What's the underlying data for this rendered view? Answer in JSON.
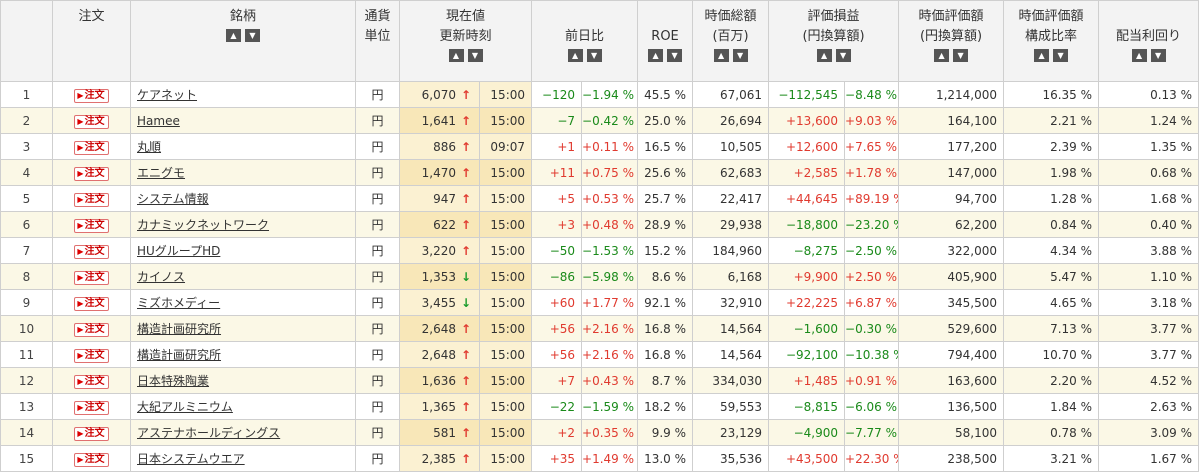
{
  "header": {
    "order": "注文",
    "name": "銘柄",
    "currency_line1": "通貨",
    "currency_line2": "単位",
    "price_line1": "現在値",
    "price_line2": "更新時刻",
    "change": "前日比",
    "roe": "ROE",
    "mcap_line1": "時価総額",
    "mcap_line2": "(百万)",
    "pl_line1": "評価損益",
    "pl_line2": "(円換算額)",
    "mv_line1": "時価評価額",
    "mv_line2": "(円換算額)",
    "ratio_line1": "時価評価額",
    "ratio_line2": "構成比率",
    "yield": "配当利回り"
  },
  "icons": {
    "sort_up": "sort-up-icon",
    "sort_down": "sort-down-icon",
    "arrow_up": "arrow-up-icon",
    "arrow_down": "arrow-down-icon"
  },
  "order_button_label": "注文",
  "colors": {
    "positive": "#e03a2f",
    "negative": "#1a8a1a",
    "price_bg": "#fbf1d2"
  },
  "rows": [
    {
      "no": "1",
      "name": "ケアネット",
      "cur": "円",
      "price": "6,070",
      "dir": "up",
      "time": "15:00",
      "chg": "−120",
      "chgp": "−1.94 %",
      "roe": "45.5 %",
      "mcap": "67,061",
      "pl": "−112,545",
      "plp": "−8.48 %",
      "mv": "1,214,000",
      "ratio": "16.35 %",
      "yield": "0.13 %"
    },
    {
      "no": "2",
      "name": "Hamee",
      "cur": "円",
      "price": "1,641",
      "dir": "up",
      "time": "15:00",
      "chg": "−7",
      "chgp": "−0.42 %",
      "roe": "25.0 %",
      "mcap": "26,694",
      "pl": "+13,600",
      "plp": "+9.03 %",
      "mv": "164,100",
      "ratio": "2.21 %",
      "yield": "1.24 %"
    },
    {
      "no": "3",
      "name": "丸順",
      "cur": "円",
      "price": "886",
      "dir": "up",
      "time": "09:07",
      "chg": "+1",
      "chgp": "+0.11 %",
      "roe": "16.5 %",
      "mcap": "10,505",
      "pl": "+12,600",
      "plp": "+7.65 %",
      "mv": "177,200",
      "ratio": "2.39 %",
      "yield": "1.35 %"
    },
    {
      "no": "4",
      "name": "エニグモ",
      "cur": "円",
      "price": "1,470",
      "dir": "up",
      "time": "15:00",
      "chg": "+11",
      "chgp": "+0.75 %",
      "roe": "25.6 %",
      "mcap": "62,683",
      "pl": "+2,585",
      "plp": "+1.78 %",
      "mv": "147,000",
      "ratio": "1.98 %",
      "yield": "0.68 %"
    },
    {
      "no": "5",
      "name": "システム情報",
      "cur": "円",
      "price": "947",
      "dir": "up",
      "time": "15:00",
      "chg": "+5",
      "chgp": "+0.53 %",
      "roe": "25.7 %",
      "mcap": "22,417",
      "pl": "+44,645",
      "plp": "+89.19 %",
      "mv": "94,700",
      "ratio": "1.28 %",
      "yield": "1.68 %"
    },
    {
      "no": "6",
      "name": "カナミックネットワーク",
      "cur": "円",
      "price": "622",
      "dir": "up",
      "time": "15:00",
      "chg": "+3",
      "chgp": "+0.48 %",
      "roe": "28.9 %",
      "mcap": "29,938",
      "pl": "−18,800",
      "plp": "−23.20 %",
      "mv": "62,200",
      "ratio": "0.84 %",
      "yield": "0.40 %"
    },
    {
      "no": "7",
      "name": "HUグループHD",
      "cur": "円",
      "price": "3,220",
      "dir": "up",
      "time": "15:00",
      "chg": "−50",
      "chgp": "−1.53 %",
      "roe": "15.2 %",
      "mcap": "184,960",
      "pl": "−8,275",
      "plp": "−2.50 %",
      "mv": "322,000",
      "ratio": "4.34 %",
      "yield": "3.88 %"
    },
    {
      "no": "8",
      "name": "カイノス",
      "cur": "円",
      "price": "1,353",
      "dir": "down",
      "time": "15:00",
      "chg": "−86",
      "chgp": "−5.98 %",
      "roe": "8.6 %",
      "mcap": "6,168",
      "pl": "+9,900",
      "plp": "+2.50 %",
      "mv": "405,900",
      "ratio": "5.47 %",
      "yield": "1.10 %"
    },
    {
      "no": "9",
      "name": "ミズホメディー",
      "cur": "円",
      "price": "3,455",
      "dir": "down",
      "time": "15:00",
      "chg": "+60",
      "chgp": "+1.77 %",
      "roe": "92.1 %",
      "mcap": "32,910",
      "pl": "+22,225",
      "plp": "+6.87 %",
      "mv": "345,500",
      "ratio": "4.65 %",
      "yield": "3.18 %"
    },
    {
      "no": "10",
      "name": "構造計画研究所",
      "cur": "円",
      "price": "2,648",
      "dir": "up",
      "time": "15:00",
      "chg": "+56",
      "chgp": "+2.16 %",
      "roe": "16.8 %",
      "mcap": "14,564",
      "pl": "−1,600",
      "plp": "−0.30 %",
      "mv": "529,600",
      "ratio": "7.13 %",
      "yield": "3.77 %"
    },
    {
      "no": "11",
      "name": "構造計画研究所",
      "cur": "円",
      "price": "2,648",
      "dir": "up",
      "time": "15:00",
      "chg": "+56",
      "chgp": "+2.16 %",
      "roe": "16.8 %",
      "mcap": "14,564",
      "pl": "−92,100",
      "plp": "−10.38 %",
      "mv": "794,400",
      "ratio": "10.70 %",
      "yield": "3.77 %"
    },
    {
      "no": "12",
      "name": "日本特殊陶業",
      "cur": "円",
      "price": "1,636",
      "dir": "up",
      "time": "15:00",
      "chg": "+7",
      "chgp": "+0.43 %",
      "roe": "8.7 %",
      "mcap": "334,030",
      "pl": "+1,485",
      "plp": "+0.91 %",
      "mv": "163,600",
      "ratio": "2.20 %",
      "yield": "4.52 %"
    },
    {
      "no": "13",
      "name": "大紀アルミニウム",
      "cur": "円",
      "price": "1,365",
      "dir": "up",
      "time": "15:00",
      "chg": "−22",
      "chgp": "−1.59 %",
      "roe": "18.2 %",
      "mcap": "59,553",
      "pl": "−8,815",
      "plp": "−6.06 %",
      "mv": "136,500",
      "ratio": "1.84 %",
      "yield": "2.63 %"
    },
    {
      "no": "14",
      "name": "アステナホールディングス",
      "cur": "円",
      "price": "581",
      "dir": "up",
      "time": "15:00",
      "chg": "+2",
      "chgp": "+0.35 %",
      "roe": "9.9 %",
      "mcap": "23,129",
      "pl": "−4,900",
      "plp": "−7.77 %",
      "mv": "58,100",
      "ratio": "0.78 %",
      "yield": "3.09 %"
    },
    {
      "no": "15",
      "name": "日本システムウエア",
      "cur": "円",
      "price": "2,385",
      "dir": "up",
      "time": "15:00",
      "chg": "+35",
      "chgp": "+1.49 %",
      "roe": "13.0 %",
      "mcap": "35,536",
      "pl": "+43,500",
      "plp": "+22.30 %",
      "mv": "238,500",
      "ratio": "3.21 %",
      "yield": "1.67 %"
    }
  ]
}
